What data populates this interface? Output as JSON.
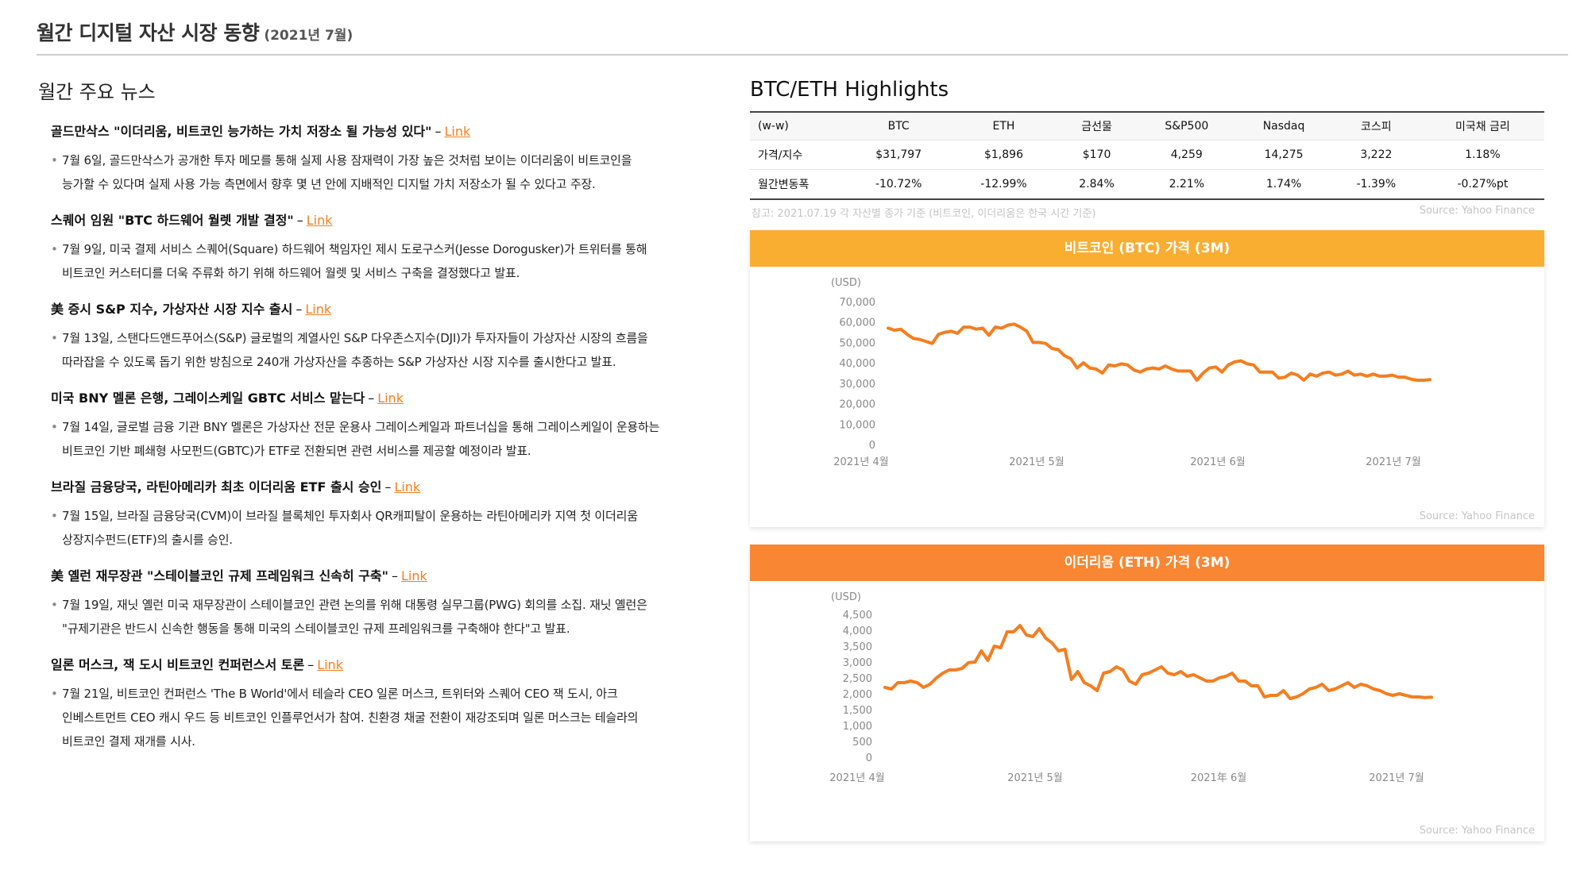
{
  "header": {
    "title": "월간 디지털 자산 시장 동향",
    "subtitle": "(2021년 7월)"
  },
  "news": {
    "section_title": "월간 주요 뉴스",
    "items": [
      {
        "headline": "골드만삭스 \"이더리움, 비트코인 능가하는 가치 저장소 될 가능성 있다\"",
        "link": "Link",
        "line1": "7월 6일, 골드만삭스가 공개한 투자 메모를 통해 실제 사용 잠재력이 가장 높은 것처럼 보이는 이더리움이 비트코인을",
        "line2": "능가할 수 있다며 실제 사용 가능 측면에서 향후 몇 년 안에 지배적인 디지털 가치 저장소가 될 수 있다고 주장.",
        "line3": ""
      },
      {
        "headline": "스퀘어 임원 \"BTC 하드웨어 월렛 개발 결정\"",
        "link": "Link",
        "line1": "7월 9일, 미국 결제 서비스 스퀘어(Square) 하드웨어 책임자인 제시 도로구스커(Jesse Dorogusker)가 트위터를 통해",
        "line2": "비트코인 커스터디를 더욱 주류화 하기 위해 하드웨어 월렛 및 서비스 구축을 결정했다고 발표.",
        "line3": ""
      },
      {
        "headline": "美 증시 S&P 지수, 가상자산 시장 지수 출시",
        "link": "Link",
        "line1": "7월 13일, 스탠다드앤드푸어스(S&P) 글로벌의 계열사인 S&P 다우존스지수(DJI)가 투자자들이 가상자산 시장의 흐름을",
        "line2": "따라잡을 수 있도록 돕기 위한 방침으로 240개 가상자산을 추종하는 S&P 가상자산 시장 지수를 출시한다고 발표.",
        "line3": ""
      },
      {
        "headline": "미국 BNY 멜론 은행, 그레이스케일 GBTC 서비스 맡는다",
        "link": "Link",
        "line1": "7월 14일, 글로벌 금융 기관 BNY 멜론은 가상자산 전문 운용사 그레이스케일과 파트너십을 통해 그레이스케일이 운용하는",
        "line2": "비트코인 기반 폐쇄형 사모펀드(GBTC)가 ETF로 전환되면 관련 서비스를 제공할 예정이라 발표.",
        "line3": ""
      },
      {
        "headline": "브라질 금융당국, 라틴아메리카 최초 이더리움 ETF 출시 승인",
        "link": "Link",
        "line1": "7월 15일, 브라질 금융당국(CVM)이 브라질 블록체인 투자회사 QR캐피탈이 운용하는 라틴아메리카 지역 첫 이더리움",
        "line2": "상장지수펀드(ETF)의 출시를 승인.",
        "line3": ""
      },
      {
        "headline": "美 옐런 재무장관 \"스테이블코인 규제 프레임워크 신속히 구축\"",
        "link": "Link",
        "line1": "7월 19일, 재닛 옐런 미국 재무장관이 스테이블코인 관련 논의를 위해 대통령 실무그룹(PWG) 회의를 소집. 재닛 옐런은",
        "line2": "\"규제기관은 반드시 신속한 행동을 통해 미국의 스테이블코인 규제 프레임워크를 구축해야 한다\"고 발표.",
        "line3": ""
      },
      {
        "headline": "일론 머스크, 잭 도시 비트코인 컨퍼런스서 토론",
        "link": "Link",
        "line1": "7월 21일, 비트코인 컨퍼런스 'The B World'에서 테슬라 CEO 일론 머스크, 트위터와 스퀘어 CEO 잭 도시, 아크",
        "line2": "인베스트먼트 CEO 캐시 우드 등 비트코인 인플루언서가 참여. 친환경 채굴 전환이 재강조되며 일론 머스크는 테슬라의",
        "line3": "비트코인 결제 재개를 시사."
      }
    ]
  },
  "highlights": {
    "title": "BTC/ETH Highlights",
    "columns": [
      "(w-w)",
      "BTC",
      "ETH",
      "금선물",
      "S&P500",
      "Nasdaq",
      "코스피",
      "미국채 금리"
    ],
    "rows": [
      [
        "가격/지수",
        "$31,797",
        "$1,896",
        "$170",
        "4,259",
        "14,275",
        "3,222",
        "1.18%"
      ],
      [
        "월간변동폭",
        "-10.72%",
        "-12.99%",
        "2.84%",
        "2.21%",
        "1.74%",
        "-1.39%",
        "-0.27%pt"
      ]
    ],
    "note": "참고: 2021.07.19 각 자산별 종가 기준 (비트코인, 이더리움은 한국 시간 기준)",
    "source": "Source: Yahoo Finance"
  },
  "btc_chart": {
    "title": "비트코인 (BTC) 가격 (3M)",
    "bar_color": "#f9ae31",
    "line_color": "#f47e20",
    "source": "Source: Yahoo Finance",
    "chart_data": {
      "type": "line",
      "unit": "(USD)",
      "ylim": [
        0,
        70000
      ],
      "y_ticks": [
        "70,000",
        "60,000",
        "50,000",
        "40,000",
        "30,000",
        "20,000",
        "10,000",
        "0"
      ],
      "x_ticks": [
        "2021년 4월",
        "2021년 5월",
        "2021년 6월",
        "2021년 7월"
      ],
      "series": [
        {
          "values": [
            57000,
            56000,
            56500,
            54000,
            52000,
            51500,
            50500,
            49500,
            54000,
            55000,
            55500,
            54500,
            57500,
            57500,
            56500,
            57000,
            53500,
            57500,
            57000,
            58500,
            59000,
            57500,
            55500,
            50000,
            50000,
            49500,
            47000,
            46500,
            43500,
            42000,
            37500,
            40000,
            37500,
            37000,
            35000,
            39000,
            38500,
            39500,
            39000,
            36500,
            35500,
            37000,
            37500,
            37000,
            38500,
            37000,
            36000,
            36000,
            36000,
            31500,
            35000,
            37500,
            38000,
            35500,
            39000,
            40500,
            41000,
            39500,
            39000,
            35500,
            35500,
            35500,
            32500,
            33000,
            35000,
            34000,
            31500,
            34500,
            33500,
            35000,
            35500,
            34000,
            34500,
            36000,
            34000,
            34500,
            33500,
            34500,
            33500,
            33500,
            34000,
            33000,
            33000,
            32000,
            31500,
            31500,
            31800
          ]
        }
      ]
    }
  },
  "eth_chart": {
    "title": "이더리움 (ETH) 가격 (3M)",
    "bar_color": "#f98632",
    "line_color": "#f47e20",
    "source": "Source: Yahoo Finance",
    "chart_data": {
      "type": "line",
      "unit": "(USD)",
      "ylim": [
        0,
        4500
      ],
      "y_ticks": [
        "4,500",
        "4,000",
        "3,500",
        "3,000",
        "2,500",
        "2,000",
        "1,500",
        "1,000",
        "500",
        "0"
      ],
      "x_ticks": [
        "2021년 4월",
        "2021년 5월",
        "2021年 6월",
        "2021년 7월"
      ],
      "series": [
        {
          "values": [
            2200,
            2150,
            2350,
            2350,
            2400,
            2350,
            2200,
            2300,
            2500,
            2650,
            2750,
            2750,
            2800,
            2980,
            3000,
            3350,
            3050,
            3500,
            3450,
            3950,
            3950,
            4150,
            3850,
            3800,
            4050,
            3750,
            3600,
            3350,
            3400,
            2450,
            2700,
            2350,
            2250,
            2100,
            2650,
            2700,
            2850,
            2750,
            2400,
            2300,
            2600,
            2650,
            2750,
            2850,
            2650,
            2600,
            2700,
            2550,
            2600,
            2500,
            2400,
            2400,
            2500,
            2550,
            2650,
            2400,
            2400,
            2250,
            2250,
            1900,
            1950,
            1950,
            2100,
            1850,
            1900,
            2000,
            2150,
            2200,
            2300,
            2100,
            2150,
            2250,
            2350,
            2200,
            2300,
            2250,
            2150,
            2100,
            2000,
            1950,
            2000,
            1950,
            1900,
            1900,
            1880,
            1890
          ]
        }
      ]
    }
  }
}
